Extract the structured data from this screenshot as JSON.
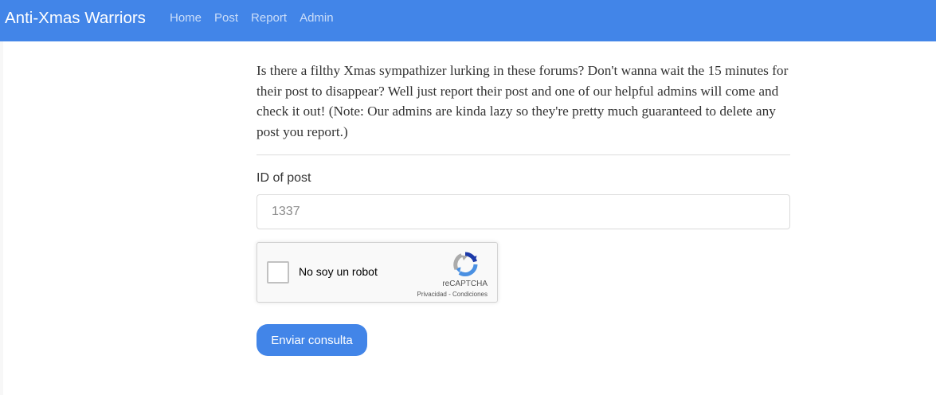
{
  "navbar": {
    "brand": "Anti-Xmas Warriors",
    "links": [
      "Home",
      "Post",
      "Report",
      "Admin"
    ],
    "color": "#4285e8"
  },
  "report": {
    "intro": "Is there a filthy Xmas sympathizer lurking in these forums? Don't wanna wait the 15 minutes for their post to disappear? Well just report their post and one of our helpful admins will come and check it out! (Note: Our admins are kinda lazy so they're pretty much guaranteed to delete any post you report.)",
    "field_label": "ID of post",
    "field_placeholder": "1337",
    "field_value": ""
  },
  "recaptcha": {
    "label": "No soy un robot",
    "brand": "reCAPTCHA",
    "privacy": "Privacidad",
    "separator": " - ",
    "terms": "Condiciones",
    "checked": false
  },
  "submit": {
    "label": "Enviar consulta",
    "color": "#4285e8"
  }
}
